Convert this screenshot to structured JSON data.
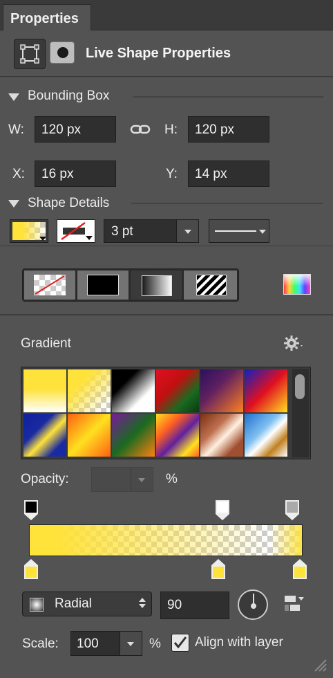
{
  "panel": {
    "tab_title": "Properties"
  },
  "live_shape": {
    "title": "Live Shape Properties"
  },
  "bounding_box": {
    "title": "Bounding Box",
    "w_label": "W:",
    "w_value": "120 px",
    "h_label": "H:",
    "h_value": "120 px",
    "x_label": "X:",
    "x_value": "16 px",
    "y_label": "Y:",
    "y_value": "14 px"
  },
  "shape_details": {
    "title": "Shape Details",
    "stroke_width": "3 pt"
  },
  "fill_types": [
    "none",
    "solid",
    "gradient",
    "pattern"
  ],
  "gradient": {
    "title": "Gradient",
    "presets_count": 12,
    "opacity_label": "Opacity:",
    "opacity_value": "",
    "percent": "%",
    "type_value": "Radial",
    "angle_value": "90",
    "scale_label": "Scale:",
    "scale_value": "100",
    "align_label": "Align with layer",
    "align_checked": true
  },
  "colors": {
    "accent_yellow": "#ffe23a",
    "panel_bg": "#535353"
  }
}
